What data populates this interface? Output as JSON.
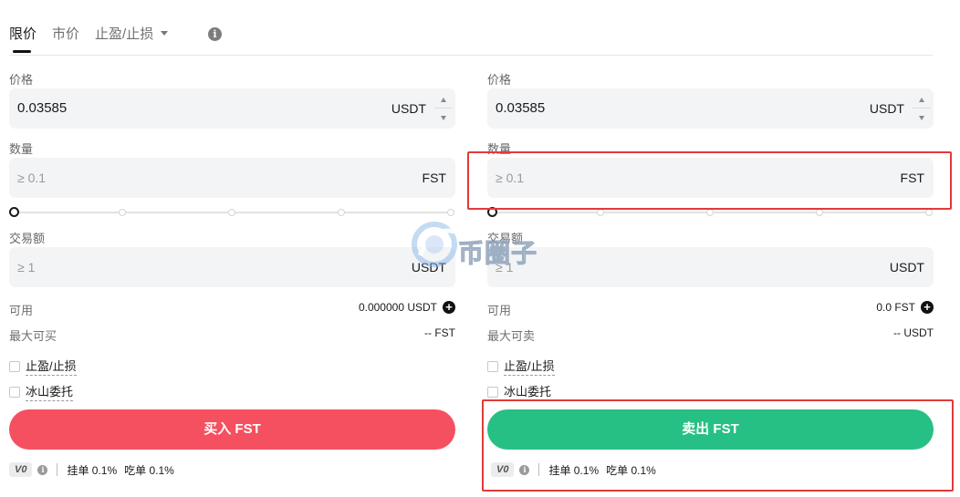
{
  "tabs": {
    "items": [
      {
        "label": "限价",
        "active": true
      },
      {
        "label": "市价",
        "active": false
      },
      {
        "label": "止盈/止损",
        "active": false
      }
    ]
  },
  "buy": {
    "price_label": "价格",
    "price_value": "0.03585",
    "price_unit": "USDT",
    "amount_label": "数量",
    "amount_placeholder": "≥ 0.1",
    "amount_unit": "FST",
    "total_label": "交易额",
    "total_placeholder": "≥ 1",
    "total_unit": "USDT",
    "available_label": "可用",
    "available_value": "0.000000 USDT",
    "max_label": "最大可买",
    "max_value": "-- FST",
    "tpsl_label": "止盈/止损",
    "iceberg_label": "冰山委托",
    "action_label": "买入 FST",
    "vip_level": "V0",
    "maker_fee": "挂单 0.1%",
    "taker_fee": "吃单 0.1%"
  },
  "sell": {
    "price_label": "价格",
    "price_value": "0.03585",
    "price_unit": "USDT",
    "amount_label": "数量",
    "amount_placeholder": "≥ 0.1",
    "amount_unit": "FST",
    "total_label": "交易额",
    "total_placeholder": "≥ 1",
    "total_unit": "USDT",
    "available_label": "可用",
    "available_value": "0.0 FST",
    "max_label": "最大可卖",
    "max_value": "-- USDT",
    "tpsl_label": "止盈/止损",
    "iceberg_label": "冰山委托",
    "action_label": "卖出 FST",
    "vip_level": "V0",
    "maker_fee": "挂单 0.1%",
    "taker_fee": "吃单 0.1%"
  },
  "watermark": "币圈子",
  "colors": {
    "buy": "#f5505f",
    "sell": "#27c084",
    "highlight": "#e23a3a"
  }
}
